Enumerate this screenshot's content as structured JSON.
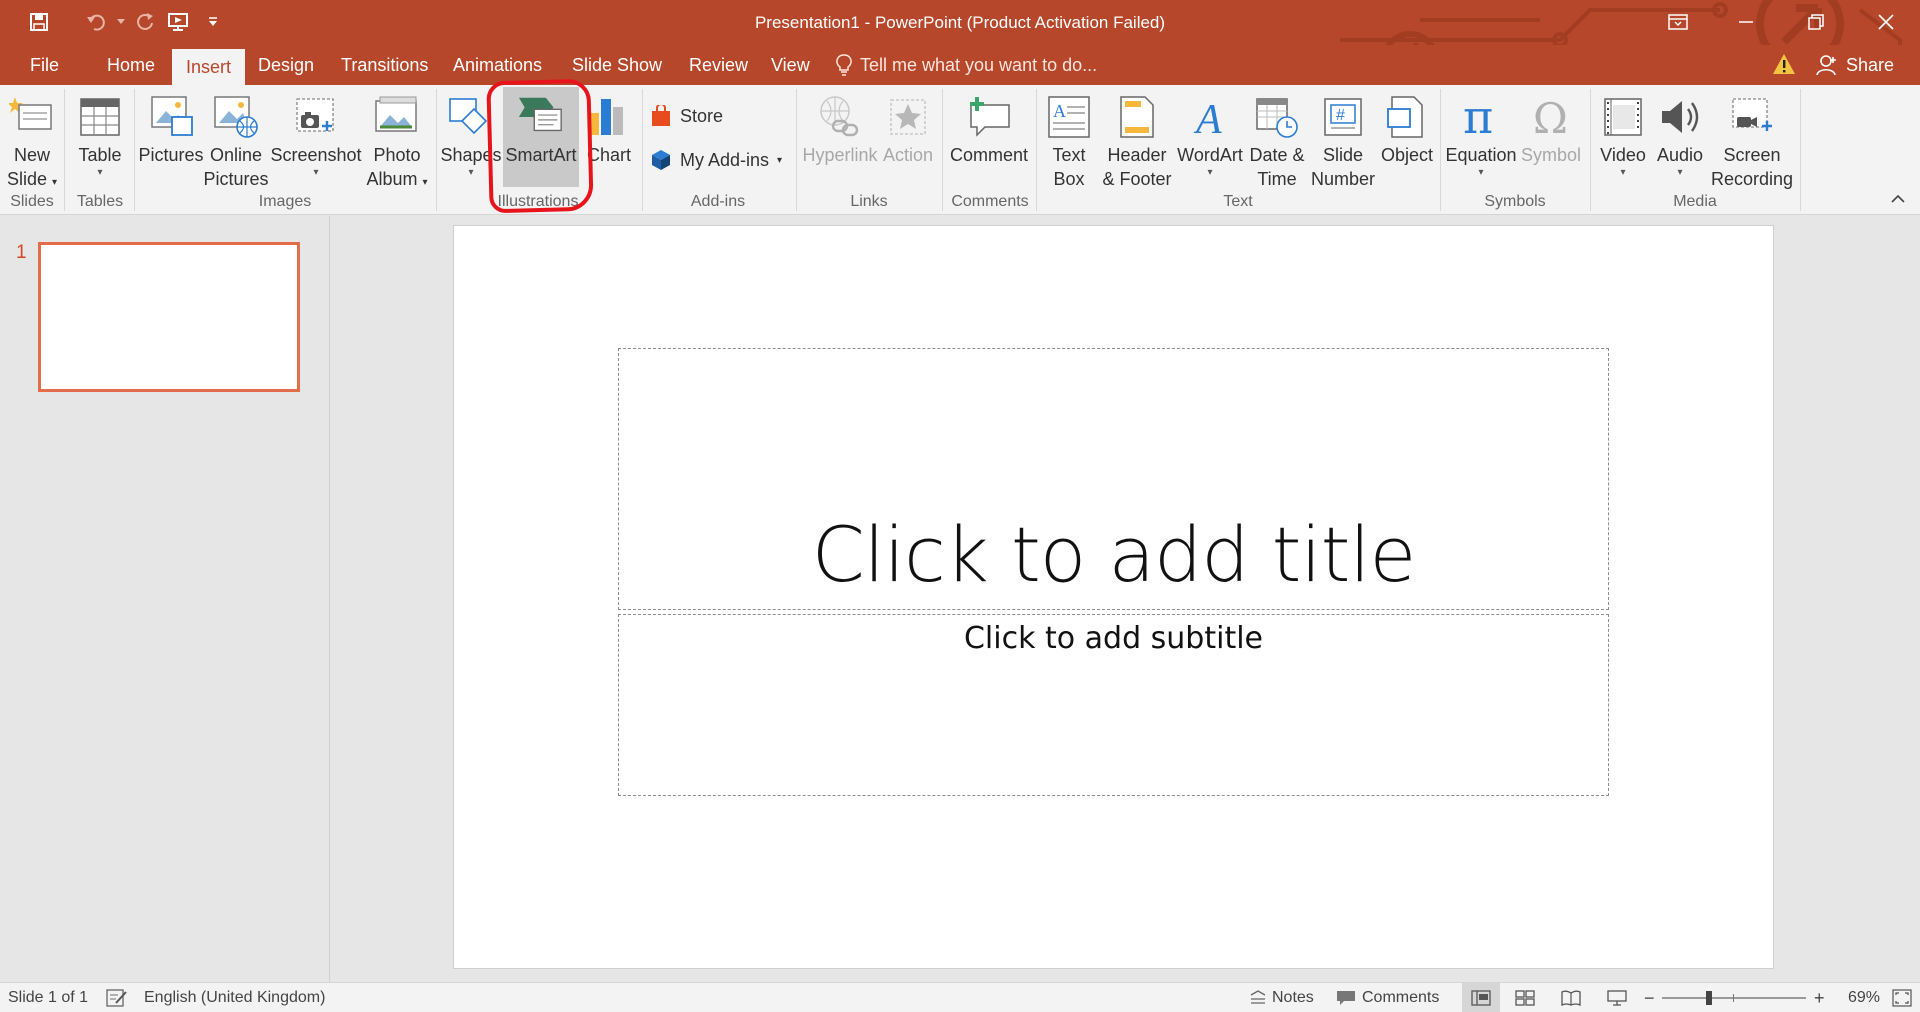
{
  "window": {
    "title": "Presentation1 - PowerPoint (Product Activation Failed)"
  },
  "quick_access": [
    "save-icon",
    "undo-icon",
    "redo-icon",
    "start-from-beginning-icon",
    "customize-qat-icon"
  ],
  "tabs": [
    {
      "label": "File",
      "active": false
    },
    {
      "label": "Home",
      "active": false
    },
    {
      "label": "Insert",
      "active": true
    },
    {
      "label": "Design",
      "active": false
    },
    {
      "label": "Transitions",
      "active": false
    },
    {
      "label": "Animations",
      "active": false
    },
    {
      "label": "Slide Show",
      "active": false
    },
    {
      "label": "Review",
      "active": false
    },
    {
      "label": "View",
      "active": false
    }
  ],
  "tell_me": {
    "text": "Tell me what you want to do..."
  },
  "share": {
    "label": "Share"
  },
  "ribbon": {
    "groups": {
      "slides": "Slides",
      "tables": "Tables",
      "images": "Images",
      "illustrations": "Illustrations",
      "addins": "Add-ins",
      "links": "Links",
      "comments": "Comments",
      "text": "Text",
      "symbols": "Symbols",
      "media": "Media"
    },
    "buttons": {
      "new_slide": [
        "New",
        "Slide"
      ],
      "table": "Table",
      "pictures": "Pictures",
      "online_pictures": [
        "Online",
        "Pictures"
      ],
      "screenshot": "Screenshot",
      "photo_album": [
        "Photo",
        "Album"
      ],
      "shapes": "Shapes",
      "smartart": "SmartArt",
      "chart": "Chart",
      "store": "Store",
      "my_addins": "My Add-ins",
      "hyperlink": "Hyperlink",
      "action": "Action",
      "comment": "Comment",
      "text_box": [
        "Text",
        "Box"
      ],
      "header_footer": [
        "Header",
        "& Footer"
      ],
      "wordart": "WordArt",
      "date_time": [
        "Date &",
        "Time"
      ],
      "slide_number": [
        "Slide",
        "Number"
      ],
      "object": "Object",
      "equation": "Equation",
      "symbol": "Symbol",
      "video": "Video",
      "audio": "Audio",
      "screen_recording": [
        "Screen",
        "Recording"
      ]
    },
    "highlighted_button": "SmartArt",
    "annotation_color": "#e8141b"
  },
  "slides_pane": {
    "slide_number": "1"
  },
  "slide": {
    "title_placeholder": "Click to add title",
    "subtitle_placeholder": "Click to add subtitle"
  },
  "status_bar": {
    "slide_info": "Slide 1 of 1",
    "language": "English (United Kingdom)",
    "notes": "Notes",
    "comments": "Comments",
    "zoom_minus": "−",
    "zoom_plus": "+",
    "zoom_percent": "69%",
    "zoom_level": 0.69
  },
  "colors": {
    "accent": "#b7472a",
    "ribbon": "#f3f3f3",
    "workspace": "#e6e6e6",
    "thumb_border": "#e46c4a"
  }
}
